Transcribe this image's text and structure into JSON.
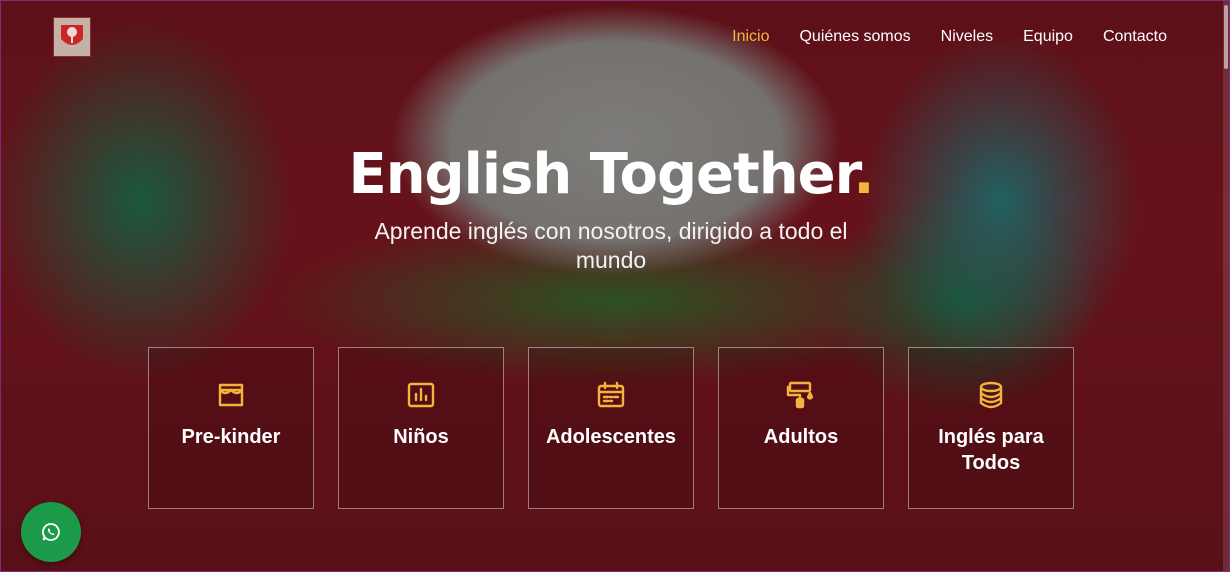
{
  "colors": {
    "accent": "#f6b33c",
    "whatsapp": "#1b9a4a"
  },
  "nav": {
    "items": [
      {
        "label": "Inicio",
        "active": true
      },
      {
        "label": "Quiénes somos"
      },
      {
        "label": "Niveles"
      },
      {
        "label": "Equipo"
      },
      {
        "label": "Contacto"
      }
    ]
  },
  "hero": {
    "title": "English Together",
    "title_dot": ".",
    "subtitle": "Aprende inglés con nosotros, dirigido a todo el mundo"
  },
  "levels": [
    {
      "label": "Pre-kinder",
      "icon": "store-icon"
    },
    {
      "label": "Niños",
      "icon": "bar-chart-icon"
    },
    {
      "label": "Adolescentes",
      "icon": "calendar-icon"
    },
    {
      "label": "Adultos",
      "icon": "paint-roller-icon"
    },
    {
      "label": "Inglés para Todos",
      "icon": "database-icon"
    }
  ],
  "whatsapp": {
    "icon": "whatsapp-icon"
  },
  "logo": {
    "icon": "tree-logo-icon"
  }
}
